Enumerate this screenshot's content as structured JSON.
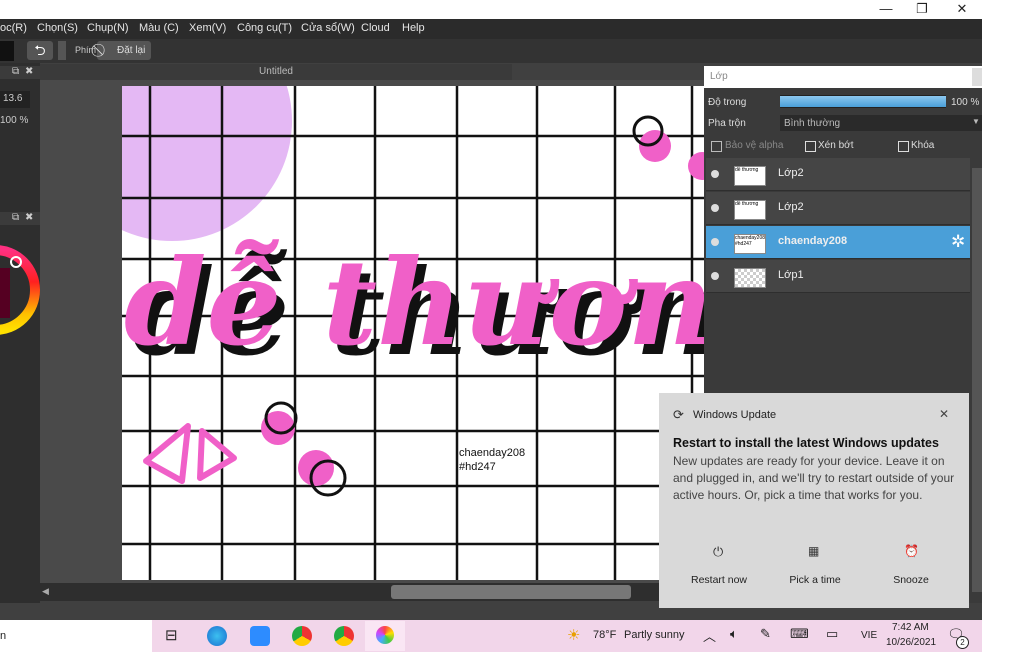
{
  "menu": [
    "oc(R)",
    "Chọn(S)",
    "Chụp(N)",
    "Màu (C)",
    "Xem(V)",
    "Công cụ(T)",
    "Cửa sổ(W)",
    "Cloud",
    "Help"
  ],
  "toolbar": {
    "phim_label": "Phím",
    "reset_label": "Đặt lại"
  },
  "left_panel": {
    "value1": "13.6",
    "value2": "100 %"
  },
  "document": {
    "title": "Untitled"
  },
  "canvas": {
    "main_text": "dễ thương",
    "signature_line1": "chaenday208",
    "signature_line2": "#hd247"
  },
  "layer_panel": {
    "title": "Lớp",
    "opacity_label": "Độ trong",
    "opacity_value": "100 %",
    "opacity_fraction": 1.0,
    "blend_label": "Pha trộn",
    "blend_value": "Bình thường",
    "protect_alpha": "Bảo vệ alpha",
    "clipping": "Xén bớt",
    "lock": "Khóa",
    "layers": [
      {
        "name": "Lớp2",
        "thumb": "dễ thương",
        "selected": false
      },
      {
        "name": "Lớp2",
        "thumb": "dễ thương",
        "selected": false
      },
      {
        "name": "chaenday208",
        "thumb": "chaenday208 #hd247",
        "selected": true
      },
      {
        "name": "Lớp1",
        "thumb": "",
        "selected": false
      }
    ]
  },
  "toast": {
    "app": "Windows Update",
    "title": "Restart to install the latest Windows updates",
    "body": "New updates are ready for your device. Leave it on and plugged in, and we'll try to restart outside of your active hours. Or, pick a time that works for you.",
    "actions": [
      "Restart now",
      "Pick a time",
      "Snooze"
    ]
  },
  "taskbar": {
    "left_text": "n",
    "weather_temp": "78°F",
    "weather_desc": "Partly sunny",
    "lang": "VIE",
    "time": "7:42 AM",
    "date": "10/26/2021",
    "notif_count": "2"
  },
  "colors": {
    "accent": "#4a9fd8",
    "pink": "#f060c8",
    "lavender": "#e4b8f4"
  }
}
